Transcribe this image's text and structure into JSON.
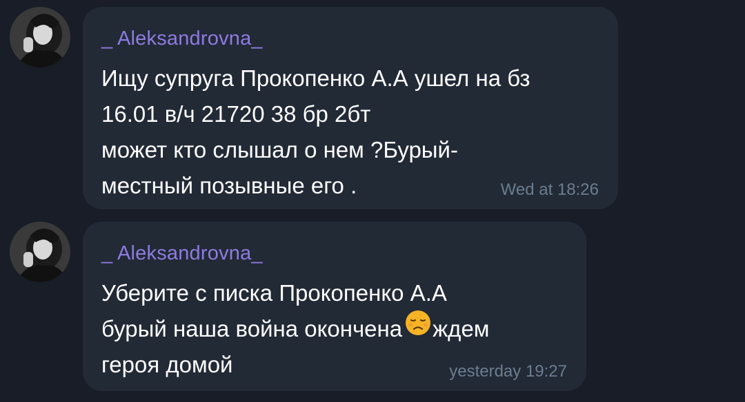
{
  "messages": [
    {
      "author": "_ Aleksandrovna_",
      "lines": [
        "Ищу супруга Прокопенко А.А ушел на бз",
        "16.01 в/ч  21720 38 бр 2бт",
        "может кто слышал о нем ?Бурый-",
        "местный позывные его ."
      ],
      "time": "Wed at 18:26",
      "avatar_icon": "profile-photo"
    },
    {
      "author": "_ Aleksandrovna_",
      "lines": [
        "Уберите с писка Прокопенко А.А",
        "бурый наша война окончена",
        "героя домой"
      ],
      "line2_suffix": "ждем",
      "emoji": "disappointed-face",
      "time": "yesterday 19:27",
      "avatar_icon": "profile-photo"
    }
  ],
  "colors": {
    "background": "#181d27",
    "bubble": "#222a36",
    "author": "#8e7be0",
    "text": "#ffffff",
    "timestamp": "#6b7d90",
    "emoji": "#f5b325"
  }
}
